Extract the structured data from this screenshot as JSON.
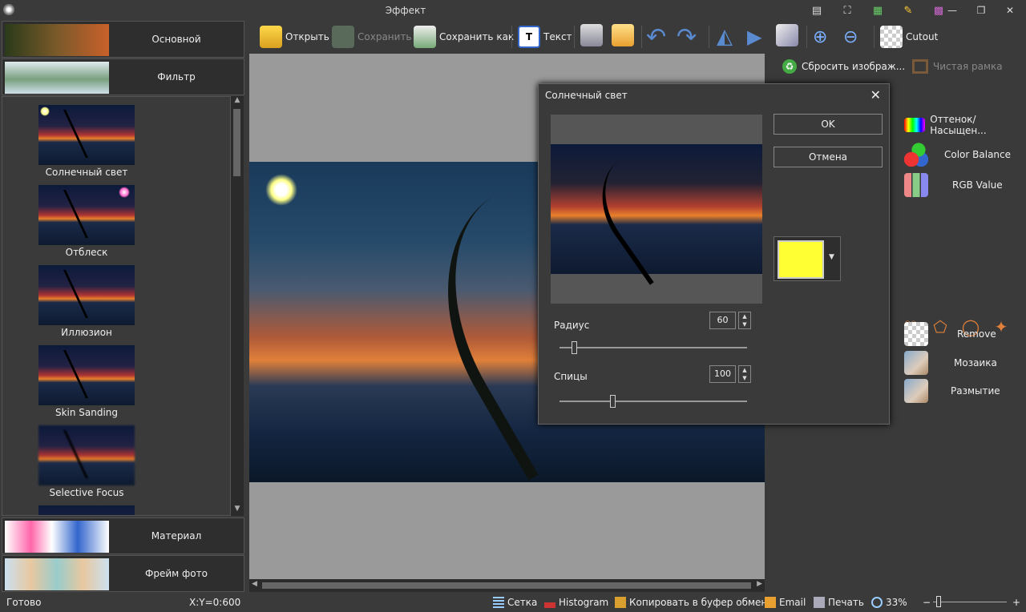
{
  "window": {
    "title": "Эффект"
  },
  "categories": [
    {
      "label": "Основной"
    },
    {
      "label": "Фильтр"
    },
    {
      "label": "Материал"
    },
    {
      "label": "Фрейм фото"
    }
  ],
  "filters": [
    {
      "name": "Солнечный свет"
    },
    {
      "name": "Отблеск"
    },
    {
      "name": "Иллюзион"
    },
    {
      "name": "Skin Sanding"
    },
    {
      "name": "Selective Focus"
    }
  ],
  "toolbar": {
    "open": "Открыть",
    "save": "Сохранить",
    "save_as": "Сохранить как",
    "text": "Текст",
    "cutout": "Cutout"
  },
  "right_panel": {
    "reset": "Сбросить изображ...",
    "clean_frame": "Чистая рамка",
    "hue_sat": "Оттенок/Насыщен...",
    "color_balance": "Color Balance",
    "rgb_value": "RGB Value",
    "remove": "Remove",
    "mosaic": "Мозаика",
    "blur": "Размытие"
  },
  "dialog": {
    "title": "Солнечный свет",
    "ok": "OK",
    "cancel": "Отмена",
    "radius_label": "Радиус",
    "radius_value": "60",
    "spokes_label": "Спицы",
    "spokes_value": "100",
    "color": "#ffff33"
  },
  "status": {
    "ready": "Готово",
    "coords": "X:Y=0:600",
    "grid": "Сетка",
    "histogram": "Histogram",
    "copy": "Копировать в буфер обмена",
    "email": "Email",
    "print": "Печать",
    "zoom": "33%",
    "minus": "−",
    "plus": "+"
  },
  "icons": [
    "app-icon",
    "open-icon",
    "save-icon",
    "save-as-icon",
    "text-icon",
    "print-icon",
    "email-icon",
    "undo-icon",
    "redo-icon",
    "flip-horizontal-icon",
    "flip-vertical-icon",
    "rotate-icon",
    "zoom-in-icon",
    "zoom-out-icon",
    "cutout-icon",
    "reset-icon",
    "frame-icon",
    "hue-icon",
    "color-balance-icon",
    "rgb-icon",
    "heart-icon",
    "lasso-icon",
    "speech-bubble-icon",
    "magic-wand-icon",
    "checker-icon",
    "mosaic-icon",
    "blur-icon"
  ]
}
